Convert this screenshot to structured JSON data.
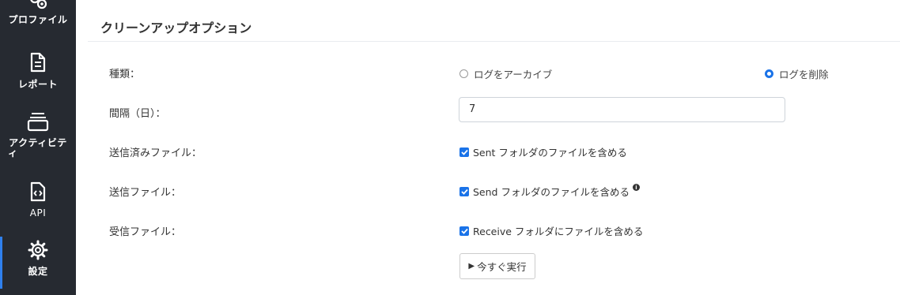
{
  "sidebar": {
    "items": [
      {
        "label": "プロファイル",
        "icon": "profile-gears-icon"
      },
      {
        "label": "レポート",
        "icon": "report-document-icon"
      },
      {
        "label": "アクティビティ",
        "icon": "activity-stack-icon"
      },
      {
        "label": "API",
        "icon": "api-code-file-icon"
      },
      {
        "label": "設定",
        "icon": "settings-gear-icon",
        "active": true
      }
    ],
    "activity_label_line1": "アクティビテ",
    "activity_label_line2": "ィ"
  },
  "section": {
    "title": "クリーンアップオプション"
  },
  "form": {
    "type_label": "種類：",
    "type_options": [
      {
        "label": "ログをアーカイブ",
        "checked": false
      },
      {
        "label": "ログを削除",
        "checked": true
      }
    ],
    "interval_label": "間隔（日）：",
    "interval_value": "7",
    "sent_files_label": "送信済みファイル：",
    "sent_files_checkbox": "Sent フォルダのファイルを含める",
    "send_files_label": "送信ファイル：",
    "send_files_checkbox": "Send フォルダのファイルを含める",
    "received_files_label": "受信ファイル：",
    "received_files_checkbox": "Receive フォルダにファイルを含める",
    "run_now_label": "今すぐ実行"
  },
  "colors": {
    "accent": "#1a73e8",
    "sidebar_bg": "#262a31",
    "active_indicator": "#2f80ed"
  }
}
